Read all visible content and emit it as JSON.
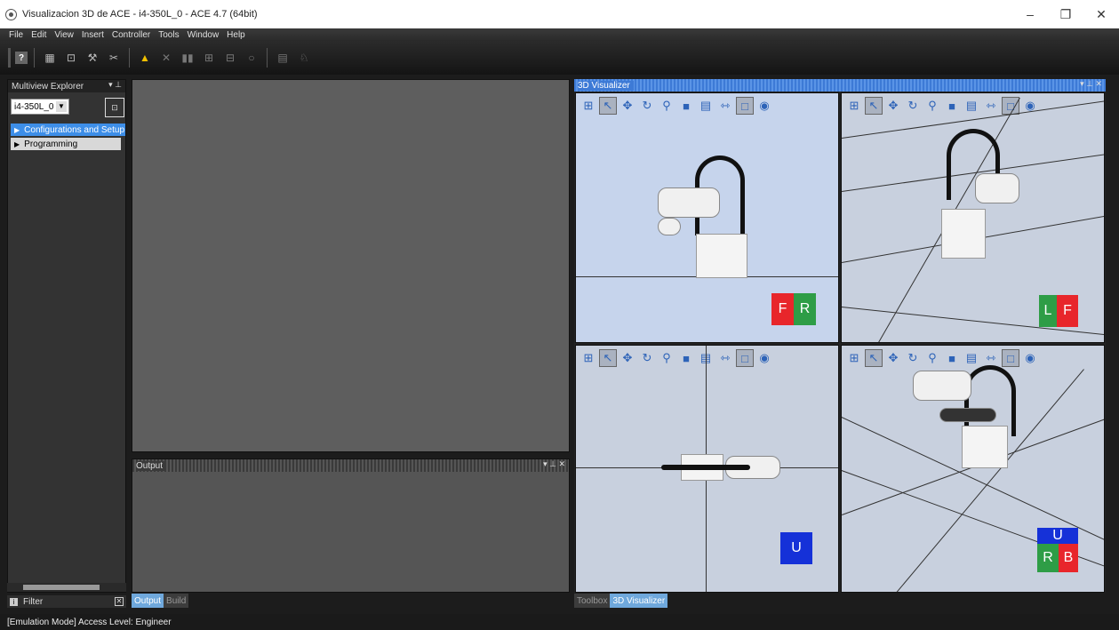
{
  "window": {
    "title": "Visualizacion 3D de ACE - i4-350L_0 - ACE 4.7 (64bit)",
    "minimize": "–",
    "restore": "❐",
    "close": "✕"
  },
  "menu": [
    "File",
    "Edit",
    "View",
    "Insert",
    "Controller",
    "Tools",
    "Window",
    "Help"
  ],
  "toolbar": {
    "help_glyph": "?"
  },
  "explorer": {
    "title": "Multiview Explorer",
    "pin": "▾ ⊥",
    "device_select": "i4-350L_0",
    "tree": [
      {
        "label": "Configurations and Setup",
        "selected": true
      },
      {
        "label": "Programming",
        "selected": false
      }
    ],
    "filter_label": "Filter"
  },
  "output": {
    "title": "Output",
    "ctrls": "▾ ⊥ ✕"
  },
  "bottom_tabs_left": [
    {
      "label": "Output",
      "active": true
    },
    {
      "label": "Build",
      "active": false
    }
  ],
  "visualizer": {
    "title": "3D Visualizer",
    "ctrls": "▾ ⊥ ✕",
    "views": [
      {
        "faces": [
          "F",
          "R"
        ],
        "colors": [
          "#e8262b",
          "#2e9d46"
        ]
      },
      {
        "faces": [
          "L",
          "F"
        ],
        "colors": [
          "#2e9d46",
          "#e8262b"
        ]
      },
      {
        "faces": [
          "U"
        ],
        "colors": [
          "#1531d8"
        ]
      },
      {
        "faces": [
          "U",
          "R",
          "B"
        ],
        "colors": [
          "#1531d8",
          "#2e9d46",
          "#e8262b"
        ]
      }
    ]
  },
  "bottom_tabs_right": [
    {
      "label": "Toolbox",
      "active": false
    },
    {
      "label": "3D Visualizer",
      "active": true
    }
  ],
  "status": "[Emulation Mode] Access Level: Engineer"
}
